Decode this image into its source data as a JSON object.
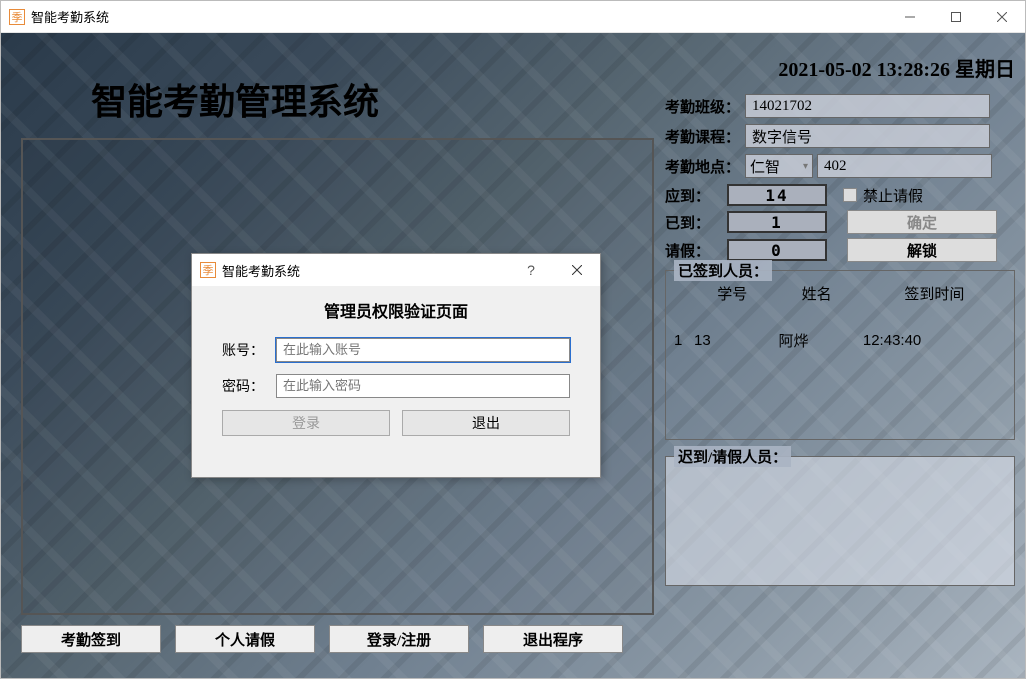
{
  "window": {
    "title": "智能考勤系统",
    "icon_glyph": "季"
  },
  "main": {
    "heading": "智能考勤管理系统"
  },
  "bottom_buttons": {
    "checkin": "考勤签到",
    "leave": "个人请假",
    "login_register": "登录/注册",
    "exit": "退出程序"
  },
  "right": {
    "datetime": "2021-05-02 13:28:26 星期日",
    "class_label": "考勤班级：",
    "class_value": "14021702",
    "course_label": "考勤课程：",
    "course_value": "数字信号",
    "location_label": "考勤地点：",
    "building": "仁智",
    "room": "402",
    "expected_label": "应到：",
    "expected_value": "14",
    "arrived_label": "已到：",
    "arrived_value": "1",
    "leave_label": "请假：",
    "leave_value": "0",
    "forbid_leave_label": "禁止请假",
    "confirm_btn": "确定",
    "unlock_btn": "解锁",
    "signed_title": "已签到人员：",
    "table": {
      "headers": {
        "sid": "学号",
        "name": "姓名",
        "time": "签到时间"
      },
      "rows": [
        {
          "idx": "1",
          "sid": "13",
          "name": "阿烨",
          "time": "12:43:40"
        }
      ]
    },
    "late_title": "迟到/请假人员："
  },
  "dialog": {
    "title": "智能考勤系统",
    "heading": "管理员权限验证页面",
    "account_label": "账号：",
    "account_placeholder": "在此输入账号",
    "password_label": "密码：",
    "password_placeholder": "在此输入密码",
    "login_btn": "登录",
    "exit_btn": "退出"
  }
}
